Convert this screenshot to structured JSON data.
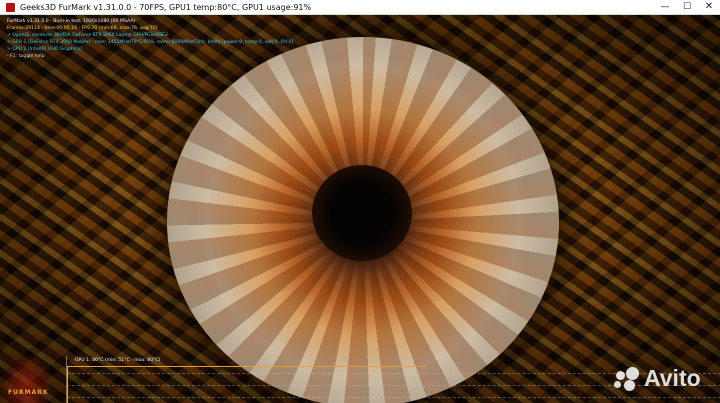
{
  "window": {
    "title": "Geeks3D FurMark v1.31.0.0 - 70FPS, GPU1 temp:80°C, GPU1 usage:91%",
    "controls": {
      "minimize": "—",
      "maximize": "☐",
      "close": "✕"
    }
  },
  "osd": [
    {
      "text": "FurMark v1.31.0.0 - Burn-in test, 1920x1080 (0X MSAA)",
      "color": "white"
    },
    {
      "text": "Frames:29114 - time:00:05:16 - FPS:70 (min:68, max:76, avg:70)",
      "color": "yellow"
    },
    {
      "text": "> OpenGL renderer: NVIDIA GeForce RTX 3060 Laptop GPU/PCIe/SSE2",
      "color": "cyan"
    },
    {
      "text": "> GPU 1 (GeForce RTX 3060 Mobile) - core: 1455MHz/79°C/91%, mem: 6000MHz/10%, limits:[power:0, temp:0, volt:0, OV:0]",
      "color": "cyan"
    },
    {
      "text": "> GPU 2 (Intel(R) UHD Graphics)",
      "color": "cyan"
    },
    {
      "text": "- F1: toggle help",
      "color": "gray"
    }
  ],
  "graph": {
    "label": "GPU 1: 80°C (min: 51°C - max: 80°C)",
    "current_temp_c": 80,
    "min_temp_c": 51,
    "max_temp_c": 80
  },
  "logo": {
    "text": "FURMARK"
  },
  "watermark": {
    "text": "Avito"
  },
  "colors": {
    "osd_yellow": "#ffd84a",
    "osd_cyan": "#3fc6ea",
    "temp_line": "#e0a040"
  }
}
